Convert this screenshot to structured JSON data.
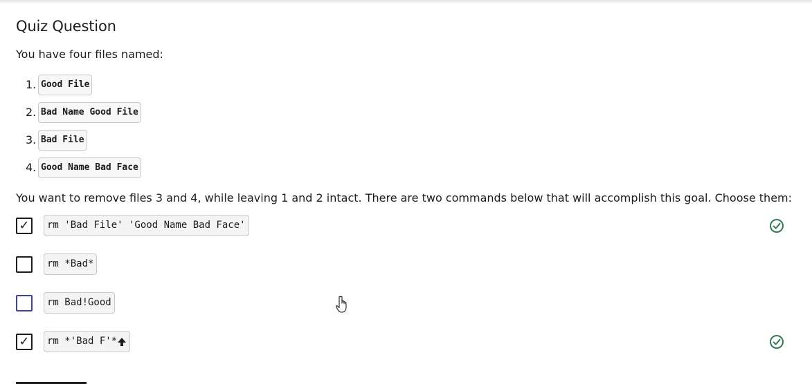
{
  "quiz": {
    "title": "Quiz Question",
    "intro": "You have four files named:",
    "files": [
      {
        "num": "1.",
        "name": "Good File"
      },
      {
        "num": "2.",
        "name": "Bad Name Good File"
      },
      {
        "num": "3.",
        "name": "Bad File"
      },
      {
        "num": "4.",
        "name": "Good Name Bad Face"
      }
    ],
    "prompt": "You want to remove files 3 and 4, while leaving 1 and 2 intact. There are two commands below that will accomplish this goal. Choose them:",
    "options": [
      {
        "command": "rm 'Bad File' 'Good Name Bad Face'",
        "checked": true,
        "mark": "✓",
        "correct": true
      },
      {
        "command": "rm *Bad*",
        "checked": false,
        "mark": "",
        "correct": false
      },
      {
        "command": "rm Bad!Good",
        "checked": false,
        "mark": "",
        "correct": false
      },
      {
        "command": "rm *'Bad F'*",
        "checked": true,
        "mark": "✓",
        "correct": true
      }
    ]
  },
  "icons": {
    "correct": "check-circle-icon",
    "cursor": "hand-pointer-icon",
    "mouse_cursor_arrow": "arrow-up-cursor-icon"
  },
  "colors": {
    "text": "#1c1c1c",
    "correct_green": "#2f7d4f",
    "focus_blue": "#3b3bd1",
    "code_border": "#c9c9c9"
  }
}
